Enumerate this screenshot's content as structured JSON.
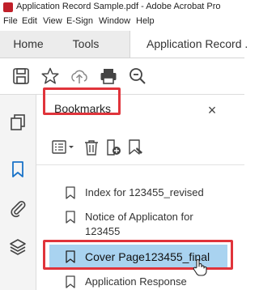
{
  "window": {
    "title": "Application Record Sample.pdf - Adobe Acrobat Pro"
  },
  "menu": [
    "File",
    "Edit",
    "View",
    "E-Sign",
    "Window",
    "Help"
  ],
  "tabs": [
    {
      "label": "Home"
    },
    {
      "label": "Tools"
    },
    {
      "label": "Application Record ."
    }
  ],
  "toolbar": {
    "icons": [
      "save-icon",
      "star-icon",
      "upload-icon",
      "print-icon",
      "zoom-icon"
    ]
  },
  "rail": {
    "icons": [
      "pages-icon",
      "bookmark-icon",
      "attachment-icon",
      "layers-icon"
    ]
  },
  "bookmarks_panel": {
    "title": "Bookmarks",
    "close": "×",
    "items": [
      {
        "label": "Index for 123455_revised"
      },
      {
        "label": "Notice of Applicaton for 123455"
      },
      {
        "label": "Cover Page123455_final"
      },
      {
        "label": "Application Response"
      }
    ]
  },
  "colors": {
    "highlight_border": "#e0343b",
    "selection": "#a9d3f0",
    "accent_blue": "#1a73c8"
  }
}
